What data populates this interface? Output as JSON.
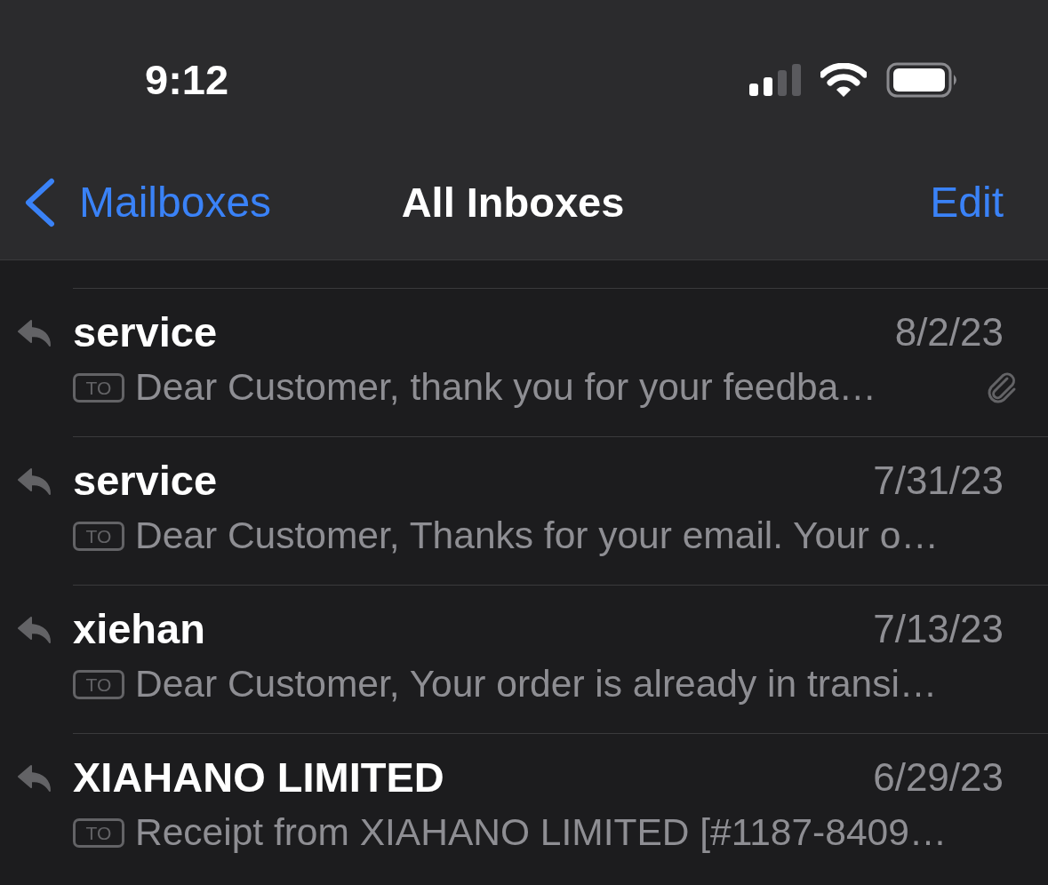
{
  "status_bar": {
    "time": "9:12"
  },
  "nav_bar": {
    "back_label": "Mailboxes",
    "title": "All Inboxes",
    "action": "Edit"
  },
  "messages": [
    {
      "sender": "service",
      "date": "8/2/23",
      "badge": "TO",
      "preview": "Dear Customer, thank you for your feedba…",
      "replied": true,
      "attachment": true
    },
    {
      "sender": "service",
      "date": "7/31/23",
      "badge": "TO",
      "preview": "Dear Customer, Thanks for your email. Your o…",
      "replied": true,
      "attachment": false
    },
    {
      "sender": "xiehan",
      "date": "7/13/23",
      "badge": "TO",
      "preview": "Dear Customer, Your order is already in transi…",
      "replied": true,
      "attachment": false
    },
    {
      "sender": "XIAHANO LIMITED",
      "date": "6/29/23",
      "badge": "TO",
      "preview": "Receipt from XIAHANO LIMITED [#1187-8409…",
      "replied": true,
      "attachment": false
    }
  ]
}
